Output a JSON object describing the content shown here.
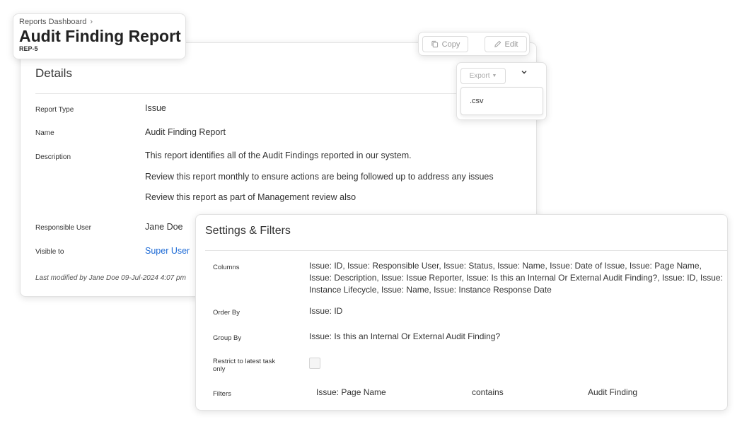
{
  "header": {
    "breadcrumb": "Reports Dashboard",
    "title": "Audit Finding Report",
    "report_id": "REP-5"
  },
  "toolbar": {
    "copy_label": "Copy",
    "edit_label": "Edit",
    "export_label": "Export",
    "export_menu": [
      ".csv"
    ]
  },
  "details": {
    "heading": "Details",
    "report_type_label": "Report Type",
    "report_type": "Issue",
    "name_label": "Name",
    "name": "Audit Finding Report",
    "description_label": "Description",
    "description": [
      "This report identifies all of the Audit Findings reported in our system.",
      "Review this report monthly to ensure actions are being followed up to address any issues",
      "Review this report as part of Management review also"
    ],
    "responsible_user_label": "Responsible User",
    "responsible_user": "Jane Doe",
    "visible_to_label": "Visible to",
    "visible_to": "Super User",
    "modified": "Last modified by Jane Doe 09-Jul-2024 4:07 pm"
  },
  "settings": {
    "heading": "Settings & Filters",
    "columns_label": "Columns",
    "columns": "Issue: ID, Issue: Responsible User, Issue: Status, Issue: Name, Issue: Date of Issue, Issue: Page Name, Issue: Description, Issue: Issue Reporter, Issue: Is this an Internal Or External Audit Finding?, Issue: ID, Issue: Instance Lifecycle, Issue: Name, Issue: Instance Response Date",
    "order_by_label": "Order By",
    "order_by": "Issue: ID",
    "group_by_label": "Group By",
    "group_by": "Issue: Is this an Internal Or External Audit Finding?",
    "restrict_label": "Restrict to latest task only",
    "restrict_checked": false,
    "filters_label": "Filters",
    "filter": {
      "field": "Issue: Page Name",
      "operator": "contains",
      "value": "Audit Finding"
    }
  },
  "colors": {
    "link": "#1e6bd6",
    "text": "#333333",
    "border": "#e2e2e2"
  },
  "icons": [
    "chevron-right-icon",
    "copy-icon",
    "pencil-icon",
    "caret-down-icon",
    "chevron-down-icon"
  ]
}
